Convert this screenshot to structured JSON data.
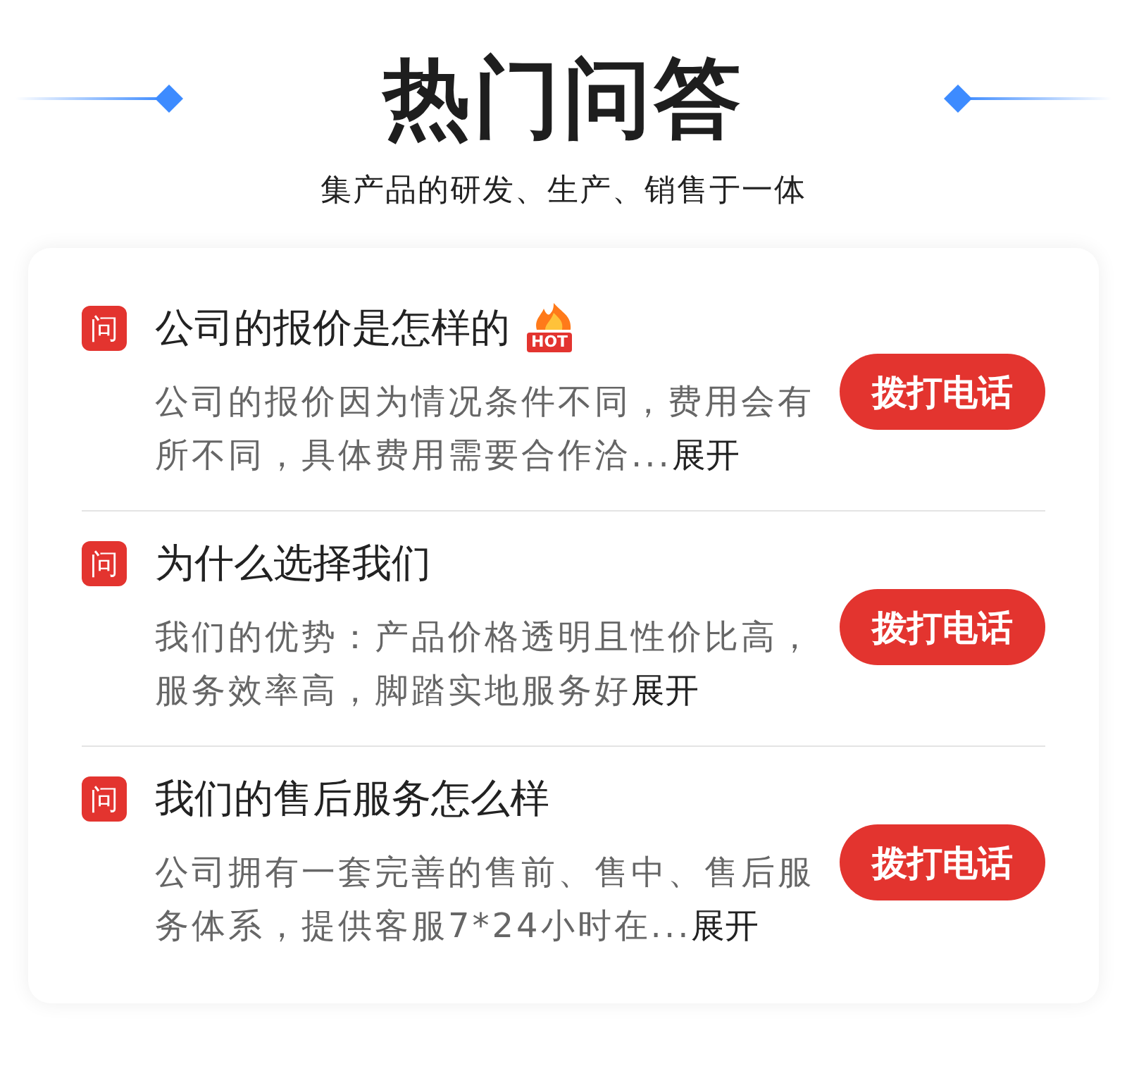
{
  "header": {
    "title": "热门问答",
    "subtitle": "集产品的研发、生产、销售于一体"
  },
  "questions": [
    {
      "mark": "问",
      "title": "公司的报价是怎样的",
      "badge": "HOT",
      "description": "公司的报价因为情况条件不同，费用会有所不同，具体费用需要合作洽...",
      "expand": "展开",
      "button": "拨打电话"
    },
    {
      "mark": "问",
      "title": "为什么选择我们",
      "description": "我们的优势：产品价格透明且性价比高，服务效率高，脚踏实地服务好",
      "expand": "展开",
      "button": "拨打电话"
    },
    {
      "mark": "问",
      "title": "我们的售后服务怎么样",
      "description": "公司拥有一套完善的售前、售中、售后服务体系，提供客服7*24小时在...",
      "expand": "展开",
      "button": "拨打电话"
    }
  ]
}
